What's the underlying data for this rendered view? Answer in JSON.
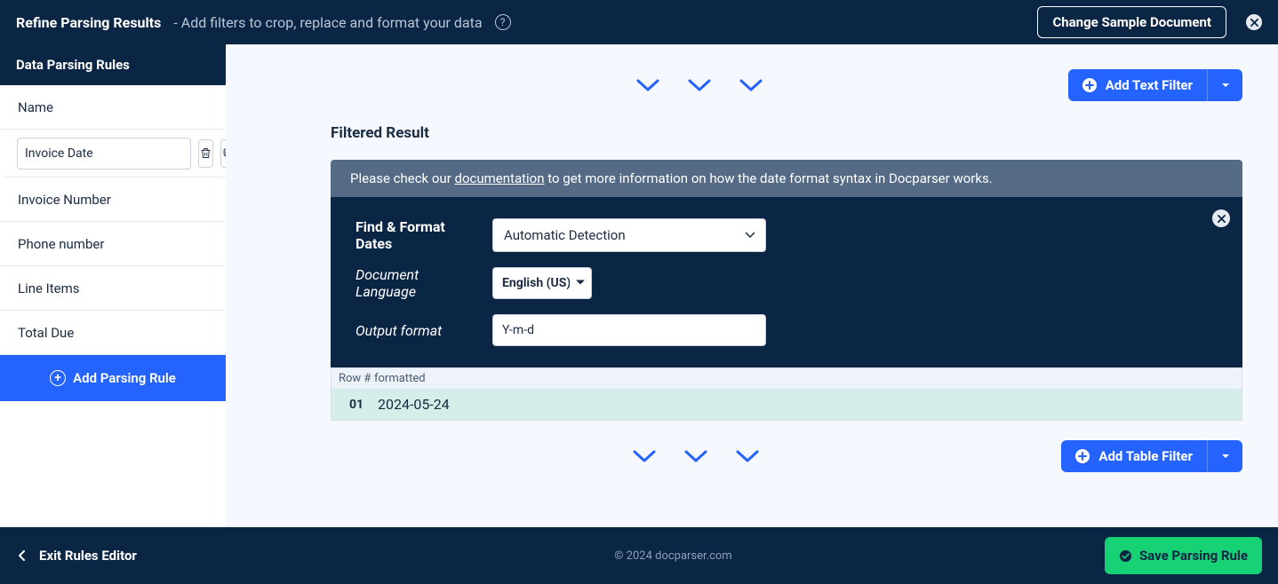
{
  "topbar": {
    "title": "Refine Parsing Results",
    "subtitle": "- Add filters to crop, replace and format your data",
    "change_doc_label": "Change Sample Document"
  },
  "sidebar": {
    "header": "Data Parsing Rules",
    "items": [
      "Name",
      "Invoice Number",
      "Phone number",
      "Line Items",
      "Total Due"
    ],
    "active_value": "Invoice Date",
    "add_rule_label": "Add Parsing Rule"
  },
  "main": {
    "add_text_filter_label": "Add Text Filter",
    "add_table_filter_label": "Add Table Filter",
    "filtered_result_title": "Filtered Result",
    "banner_pre": "Please check our ",
    "banner_link": "documentation",
    "banner_post": " to get more information on how the date format syntax in Docparser works.",
    "config": {
      "find_label": "Find & Format Dates",
      "detection_selected": "Automatic Detection",
      "lang_label": "Document Language",
      "lang_selected": "English (US)",
      "output_label": "Output format",
      "output_value": "Y-m-d"
    },
    "table": {
      "head_row": "Row #",
      "head_fmt": "formatted",
      "row_num": "01",
      "row_val": "2024-05-24"
    }
  },
  "footer": {
    "exit_label": "Exit Rules Editor",
    "copyright": "© 2024 docparser.com",
    "save_label": "Save Parsing Rule"
  }
}
